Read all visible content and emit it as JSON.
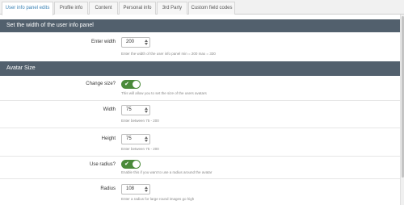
{
  "tabs": [
    {
      "label": "User info panel edits",
      "active": true
    },
    {
      "label": "Profile info",
      "active": false
    },
    {
      "label": "Content",
      "active": false
    },
    {
      "label": "Personal info",
      "active": false
    },
    {
      "label": "3rd Party",
      "active": false
    },
    {
      "label": "Custom field codes",
      "active": false
    }
  ],
  "section1": {
    "title": "Set the width of the user info panel",
    "enter_width": {
      "label": "Enter width",
      "value": "200",
      "help": "Enter the width of the user info panel min = 200 max = 330"
    }
  },
  "section2": {
    "title": "Avatar Size",
    "change_size": {
      "label": "Change size?",
      "checked": true,
      "help": "This will allow you to set the size of the users avatars"
    },
    "width": {
      "label": "Width",
      "value": "75",
      "help": "Enter between 75 - 200"
    },
    "height": {
      "label": "Height",
      "value": "75",
      "help": "Enter between 75 - 200"
    },
    "use_radius": {
      "label": "Use radius?",
      "checked": true,
      "help": "Enable this if you want to use a radius around the avatar"
    },
    "radius": {
      "label": "Radius",
      "value": "108",
      "help": "Enter a radius for large round images go high"
    }
  },
  "colors": {
    "header_bg": "#52606d",
    "toggle_on": "#4a8a3a",
    "active_tab_text": "#3b82b5"
  },
  "icons": {
    "toggle_check": "✔"
  }
}
